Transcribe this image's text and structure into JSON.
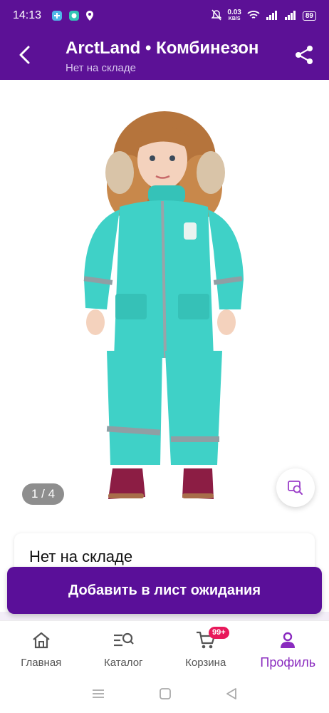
{
  "status_bar": {
    "time": "14:13",
    "net_speed_value": "0.03",
    "net_speed_unit": "KB/S",
    "battery": "89"
  },
  "header": {
    "title": "ArctLand • Комбинезон",
    "subtitle": "Нет на складе",
    "back_icon": "back-arrow-icon",
    "share_icon": "share-icon"
  },
  "gallery": {
    "page_indicator": "1 / 4",
    "current_page": 1,
    "total_pages": 4,
    "suit_color": "#3fd1c7"
  },
  "stock": {
    "text": "Нет на складе"
  },
  "actions": {
    "waitlist_label": "Добавить в лист ожидания"
  },
  "bottom_nav": {
    "items": [
      {
        "label": "Главная",
        "icon": "home-icon"
      },
      {
        "label": "Каталог",
        "icon": "catalog-search-icon"
      },
      {
        "label": "Корзина",
        "icon": "cart-icon",
        "badge": "99+"
      },
      {
        "label": "Профиль",
        "icon": "profile-icon",
        "active": true
      }
    ]
  },
  "colors": {
    "brand": "#5c1196",
    "active_nav": "#8a2bbf",
    "badge": "#e8195b"
  }
}
